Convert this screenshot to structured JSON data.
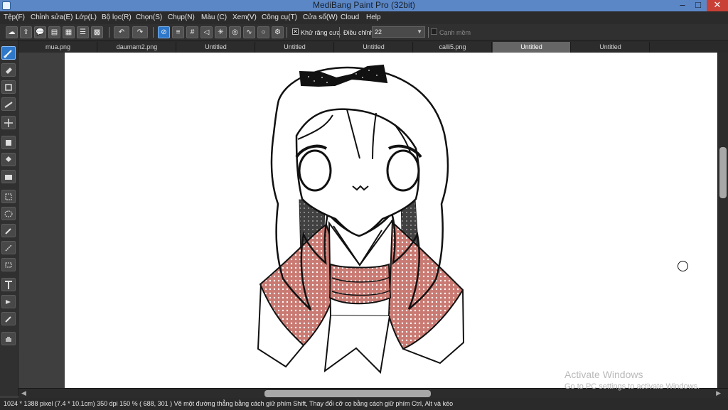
{
  "app": {
    "title": "MediBang Paint Pro (32bit)"
  },
  "window_controls": {
    "minimize": "–",
    "maximize": "□",
    "close": "✕"
  },
  "menu": {
    "items": [
      "Tệp(F)",
      "Chỉnh sửa(E)",
      "Lớp(L)",
      "Bộ lọc(R)",
      "Chọn(S)",
      "Chụp(N)",
      "Màu (C)",
      "Xem(V)",
      "Công cụ(T)",
      "Cửa sổ(W)",
      "Cloud",
      "Help"
    ]
  },
  "toolbar": {
    "antialias_label": "Khử răng cưa",
    "antialias_checked": "✕",
    "adjust_label": "Điều chỉnh",
    "adjust_value": "22",
    "edge_label": "Cạnh mềm",
    "icons": [
      "cloud-icon",
      "upload-icon",
      "comment-icon",
      "note-icon",
      "document-icon",
      "layers-icon",
      "grid-icon",
      "undo-icon",
      "redo-icon",
      "no-snap-icon",
      "parallel-snap-icon",
      "grid-snap-icon",
      "perspective-snap-icon",
      "radial-snap-icon",
      "concentric-snap-icon",
      "curve-snap-icon",
      "ellipse-snap-icon",
      "settings-icon"
    ]
  },
  "tabs": [
    "mua.png",
    "daumam2.png",
    "Untitled",
    "Untitled",
    "Untitled",
    "calli5.png",
    "Untitled",
    "Untitled"
  ],
  "tools": [
    "brush-tool-icon",
    "eraser-tool-icon",
    "rectangle-tool-icon",
    "line-tool-icon",
    "move-tool-icon",
    "fill-tool-icon",
    "bucket-tool-icon",
    "gradient-tool-icon",
    "select-rect-tool-icon",
    "lasso-tool-icon",
    "magic-wand-tool-icon",
    "select-pen-tool-icon",
    "select-eraser-tool-icon",
    "text-tool-icon",
    "operation-tool-icon",
    "eyedropper-tool-icon",
    "hand-tool-icon"
  ],
  "status": {
    "text": "1024 * 1388 pixel   (7.4 * 10.1cm)   350 dpi   150 %   ( 688, 301 )  Vẽ một đường thẳng bằng cách giữ phím Shift, Thay đổi cỡ cọ bằng cách giữ phím Ctrl, Alt và kéo"
  },
  "watermark": {
    "line1": "Activate Windows",
    "line2": "Go to PC settings to activate Windows."
  },
  "colors": {
    "title_bar": "#5b87c7",
    "accent": "#2e78c9",
    "kimono_red": "#c97a72",
    "hair_dark": "#414141"
  }
}
